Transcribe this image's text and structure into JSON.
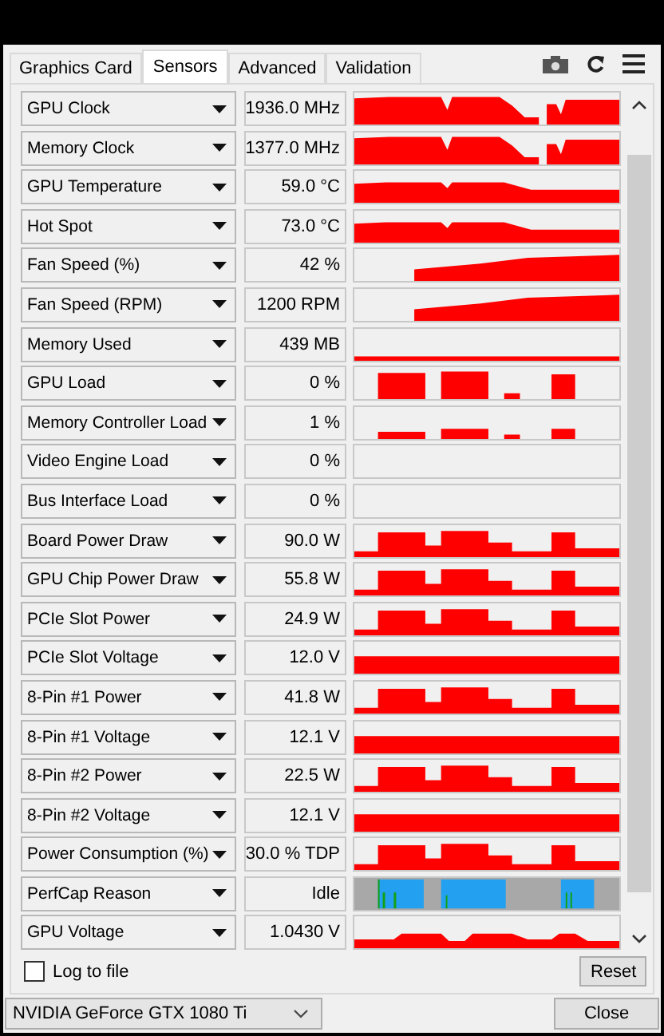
{
  "tabs": [
    {
      "label": "Graphics Card",
      "selected": false
    },
    {
      "label": "Sensors",
      "selected": true
    },
    {
      "label": "Advanced",
      "selected": false
    },
    {
      "label": "Validation",
      "selected": false
    }
  ],
  "sensors": [
    {
      "name": "GPU Clock",
      "value": "1936.0 MHz",
      "kind": "graph"
    },
    {
      "name": "Memory Clock",
      "value": "1377.0 MHz",
      "kind": "graph"
    },
    {
      "name": "GPU Temperature",
      "value": "59.0 °C",
      "kind": "graph"
    },
    {
      "name": "Hot Spot",
      "value": "73.0 °C",
      "kind": "graph"
    },
    {
      "name": "Fan Speed (%)",
      "value": "42 %",
      "kind": "graph"
    },
    {
      "name": "Fan Speed (RPM)",
      "value": "1200 RPM",
      "kind": "graph"
    },
    {
      "name": "Memory Used",
      "value": "439 MB",
      "kind": "graph"
    },
    {
      "name": "GPU Load",
      "value": "0 %",
      "kind": "graph"
    },
    {
      "name": "Memory Controller Load",
      "value": "1 %",
      "kind": "graph"
    },
    {
      "name": "Video Engine Load",
      "value": "0 %",
      "kind": "graph"
    },
    {
      "name": "Bus Interface Load",
      "value": "0 %",
      "kind": "graph"
    },
    {
      "name": "Board Power Draw",
      "value": "90.0 W",
      "kind": "graph"
    },
    {
      "name": "GPU Chip Power Draw",
      "value": "55.8 W",
      "kind": "graph"
    },
    {
      "name": "PCIe Slot Power",
      "value": "24.9 W",
      "kind": "graph"
    },
    {
      "name": "PCIe Slot Voltage",
      "value": "12.0 V",
      "kind": "graph"
    },
    {
      "name": "8-Pin #1 Power",
      "value": "41.8 W",
      "kind": "graph"
    },
    {
      "name": "8-Pin #1 Voltage",
      "value": "12.1 V",
      "kind": "graph"
    },
    {
      "name": "8-Pin #2 Power",
      "value": "22.5 W",
      "kind": "graph"
    },
    {
      "name": "8-Pin #2 Voltage",
      "value": "12.1 V",
      "kind": "graph"
    },
    {
      "name": "Power Consumption (%)",
      "value": "30.0 % TDP",
      "kind": "graph"
    },
    {
      "name": "PerfCap Reason",
      "value": "Idle",
      "kind": "perfcap"
    },
    {
      "name": "GPU Voltage",
      "value": "1.0430 V",
      "kind": "graph"
    }
  ],
  "log_to_file": {
    "label": "Log to file",
    "checked": false
  },
  "reset_button": "Reset",
  "gpu_select": {
    "value": "NVIDIA GeForce GTX 1080 Ti"
  },
  "close_button": "Close"
}
